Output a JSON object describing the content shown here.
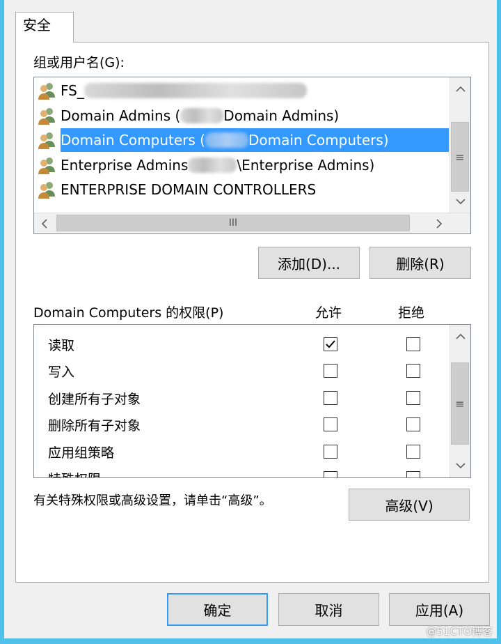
{
  "tab": {
    "label": "安全"
  },
  "groups": {
    "label": "组或用户名(G):",
    "items": [
      {
        "text_pre": "FS_",
        "text_post": "",
        "selected": false
      },
      {
        "text_pre": "Domain Admins (",
        "text_post": "Domain Admins)",
        "selected": false
      },
      {
        "text_pre": "Domain Computers (",
        "text_post": "Domain Computers)",
        "selected": true
      },
      {
        "text_pre": "Enterprise Admins",
        "text_post": "\\Enterprise Admins)",
        "selected": false
      },
      {
        "text_pre": "ENTERPRISE DOMAIN CONTROLLERS",
        "text_post": "",
        "selected": false
      }
    ]
  },
  "buttons": {
    "add": "添加(D)...",
    "remove": "删除(R)",
    "advanced": "高级(V)",
    "ok": "确定",
    "cancel": "取消",
    "apply": "应用(A)"
  },
  "permissions": {
    "label": "Domain Computers 的权限(P)",
    "allow_header": "允许",
    "deny_header": "拒绝",
    "rows": [
      {
        "name": "读取",
        "allow": true,
        "deny": false
      },
      {
        "name": "写入",
        "allow": false,
        "deny": false
      },
      {
        "name": "创建所有子对象",
        "allow": false,
        "deny": false
      },
      {
        "name": "删除所有子对象",
        "allow": false,
        "deny": false
      },
      {
        "name": "应用组策略",
        "allow": false,
        "deny": false
      },
      {
        "name": "特殊权限",
        "allow": false,
        "deny": false
      }
    ]
  },
  "advanced_hint": "有关特殊权限或高级设置，请单击“高级”。",
  "scroll_grip": "≡",
  "hscroll_grip": "III",
  "watermark": "@51CTO博客",
  "icons": {
    "group": "users-group-icon",
    "check": "checkmark-icon"
  }
}
